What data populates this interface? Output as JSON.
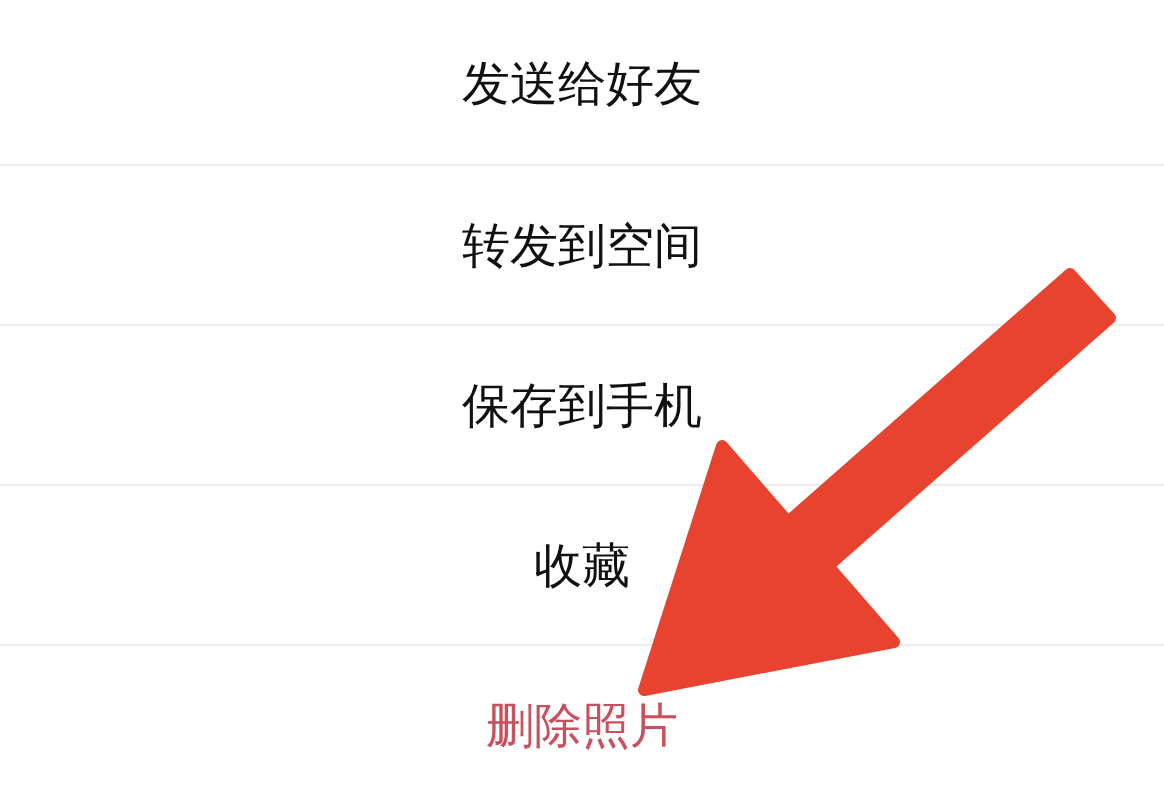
{
  "action_sheet": {
    "items": [
      {
        "label": "发送给好友",
        "kind": "action"
      },
      {
        "label": "转发到空间",
        "kind": "action"
      },
      {
        "label": "保存到手机",
        "kind": "action"
      },
      {
        "label": "收藏",
        "kind": "action"
      },
      {
        "label": "删除照片",
        "kind": "destructive"
      }
    ]
  }
}
